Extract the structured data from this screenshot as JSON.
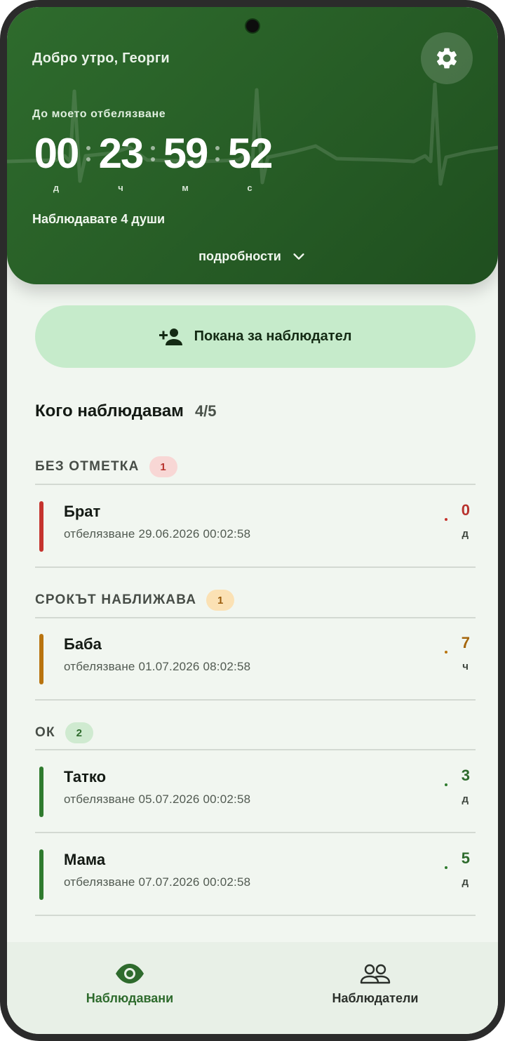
{
  "header": {
    "greeting": "Добро утро, Георги",
    "timer_label": "До моето отбелязване",
    "timer": [
      {
        "value": "00",
        "unit": "д"
      },
      {
        "value": "23",
        "unit": "ч"
      },
      {
        "value": "59",
        "unit": "м"
      },
      {
        "value": "52",
        "unit": "с"
      }
    ],
    "watching_text": "Наблюдавате 4 души",
    "details_label": "подробности",
    "settings_icon": "gear-icon"
  },
  "invite_button": {
    "label": "Покана за наблюдател",
    "icon": "person-add-icon"
  },
  "section": {
    "title": "Кого наблюдавам",
    "count": "4/5"
  },
  "groups": [
    {
      "name": "БЕЗ ОТМЕТКА",
      "count": "1",
      "badge_bg": "#f8d7d5",
      "badge_fg": "#b8332e",
      "accent": "#c5342e",
      "items": [
        {
          "name": "Брат",
          "date": "отбелязване 29.06.2026 00:02:58",
          "value": "0",
          "unit": "д"
        }
      ]
    },
    {
      "name": "СРОКЪТ НАБЛИЖАВА",
      "count": "1",
      "badge_bg": "#fbe1b4",
      "badge_fg": "#9a5b0a",
      "accent": "#b9740f",
      "items": [
        {
          "name": "Баба",
          "date": "отбелязване 01.07.2026 08:02:58",
          "value": "7",
          "unit": "ч"
        }
      ]
    },
    {
      "name": "ОК",
      "count": "2",
      "badge_bg": "#cfead0",
      "badge_fg": "#2e6b2d",
      "accent": "#2f7b2e",
      "items": [
        {
          "name": "Татко",
          "date": "отбелязване 05.07.2026 00:02:58",
          "value": "3",
          "unit": "д"
        },
        {
          "name": "Мама",
          "date": "отбелязване 07.07.2026 00:02:58",
          "value": "5",
          "unit": "д"
        }
      ]
    }
  ],
  "bottom_nav": [
    {
      "label": "Наблюдавани",
      "icon": "eye-icon",
      "active": true,
      "color": "#2e6b2d"
    },
    {
      "label": "Наблюдатели",
      "icon": "people-icon",
      "active": false,
      "color": "#2b302b"
    }
  ]
}
